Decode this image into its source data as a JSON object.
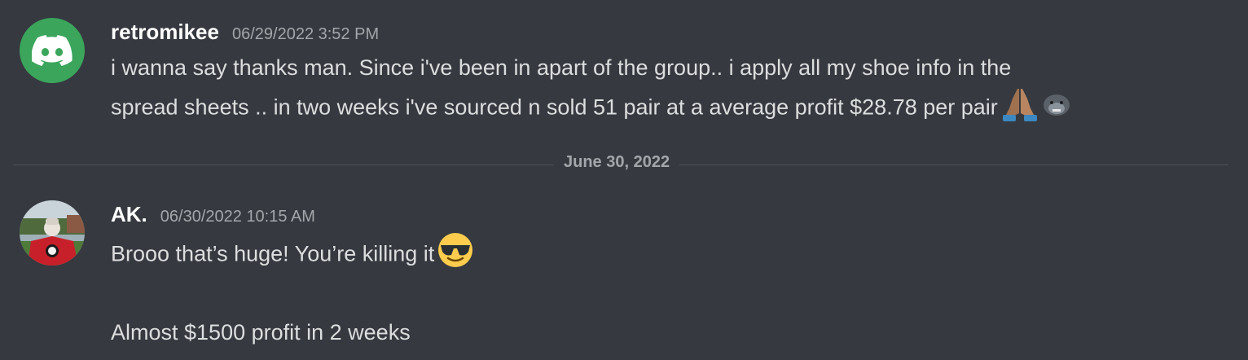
{
  "messages": [
    {
      "username": "retromikee",
      "timestamp": "06/29/2022 3:52 PM",
      "avatar_icon": "discord-logo-icon",
      "avatar_color": "#3ba55c",
      "text_line1": "i wanna say thanks man. Since i've been in apart of the group..  i apply all my shoe info in the",
      "text_line2": "spread sheets .. in two weeks i've sourced n sold 51 pair at a average profit $28.78 per pair",
      "emojis": [
        "folded-hands-emoji",
        "gorilla-emoji"
      ]
    },
    {
      "username": "AK.",
      "timestamp": "06/30/2022 10:15 AM",
      "avatar_icon": "user-photo-avatar",
      "text_line1": "Brooo that’s huge! You’re killing it",
      "emojis": [
        "sunglasses-emoji"
      ],
      "text_line2": "Almost $1500 profit in 2 weeks"
    }
  ],
  "date_divider": "June 30, 2022",
  "colors": {
    "background": "#36393f",
    "username": "#ffffff",
    "timestamp": "#a3a6aa",
    "text": "#dcddde",
    "divider": "#4f545c"
  }
}
